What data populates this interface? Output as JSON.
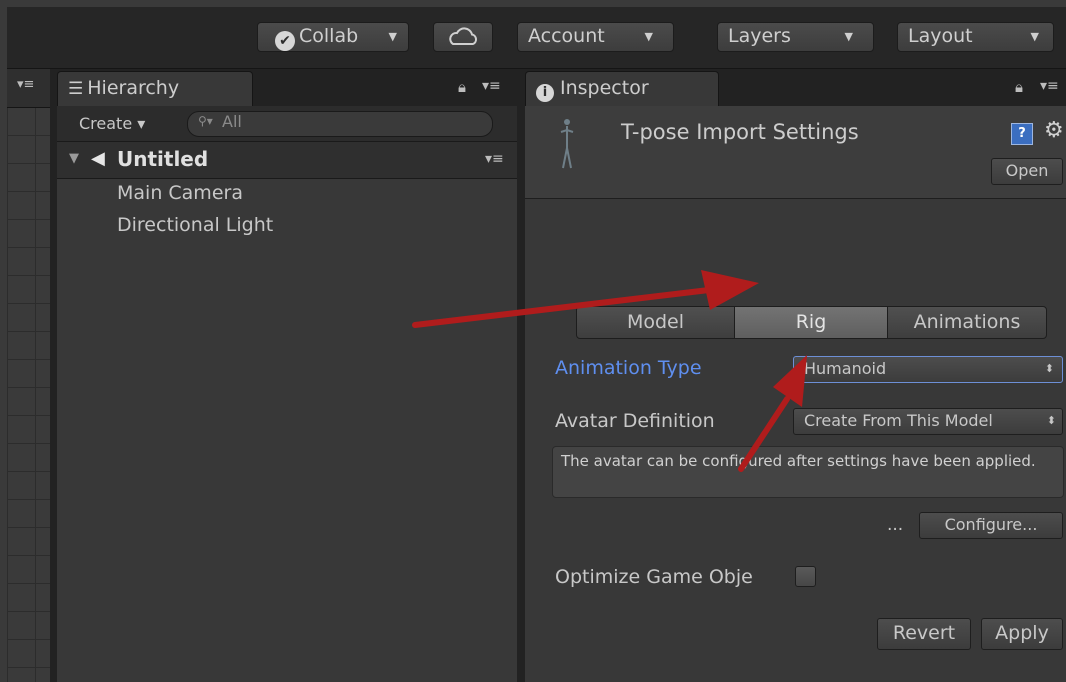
{
  "toolbar": {
    "collab_label": "Collab",
    "account_label": "Account",
    "layers_label": "Layers",
    "layout_label": "Layout"
  },
  "hierarchy": {
    "tab_label": "Hierarchy",
    "create_label": "Create",
    "search_placeholder": "All",
    "scene_name": "Untitled",
    "items": [
      {
        "label": "Main Camera"
      },
      {
        "label": "Directional Light"
      }
    ]
  },
  "inspector": {
    "tab_label": "Inspector",
    "title": "T-pose Import Settings",
    "open_label": "Open",
    "tabs": [
      {
        "label": "Model"
      },
      {
        "label": "Rig"
      },
      {
        "label": "Animations"
      }
    ],
    "animation_type_label": "Animation Type",
    "animation_type_value": "Humanoid",
    "avatar_definition_label": "Avatar Definition",
    "avatar_definition_value": "Create From This Model",
    "help_text": "The avatar can be configured after settings have been applied.",
    "ellipsis": "...",
    "configure_label": "Configure...",
    "optimize_label": "Optimize Game Obje",
    "revert_label": "Revert",
    "apply_label": "Apply"
  },
  "colors": {
    "accent_label": "#5f8ff0",
    "arrow": "#b01c1c"
  }
}
